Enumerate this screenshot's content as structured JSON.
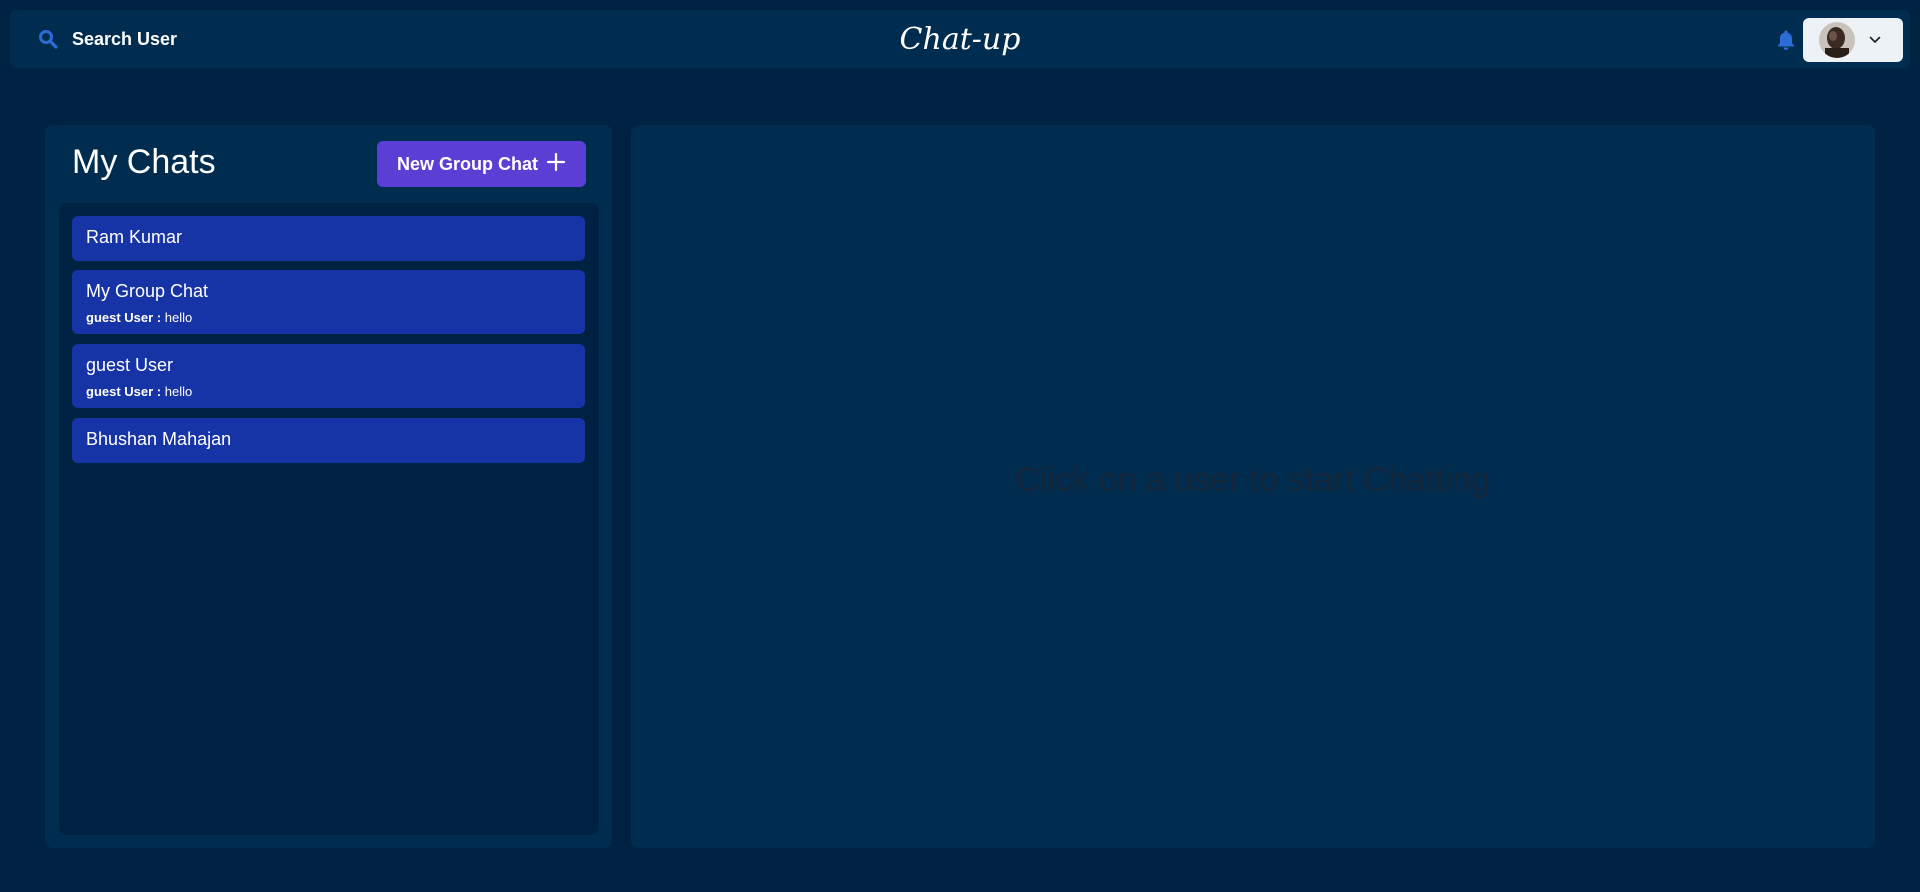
{
  "header": {
    "search_label": "Search User",
    "brand": "Chat-up"
  },
  "icons": {
    "search": "search-icon",
    "bell": "bell-icon",
    "chevron": "chevron-down-icon",
    "plus": "plus-icon"
  },
  "colors": {
    "page_bg": "#002242",
    "panel_bg": "#002d4f",
    "accent_button": "#5b3fd4",
    "chat_item_bg": "#1734a6",
    "icon_blue": "#2b6cd6"
  },
  "chats_panel": {
    "title": "My Chats",
    "new_group_label": "New Group Chat",
    "items": [
      {
        "name": "Ram Kumar"
      },
      {
        "name": "My Group Chat",
        "last_sender": "guest User :",
        "last_message": "hello"
      },
      {
        "name": "guest User",
        "last_sender": "guest User :",
        "last_message": "hello"
      },
      {
        "name": "Bhushan Mahajan"
      }
    ]
  },
  "conversation": {
    "empty_message": "Click on a user to start Chatting"
  }
}
